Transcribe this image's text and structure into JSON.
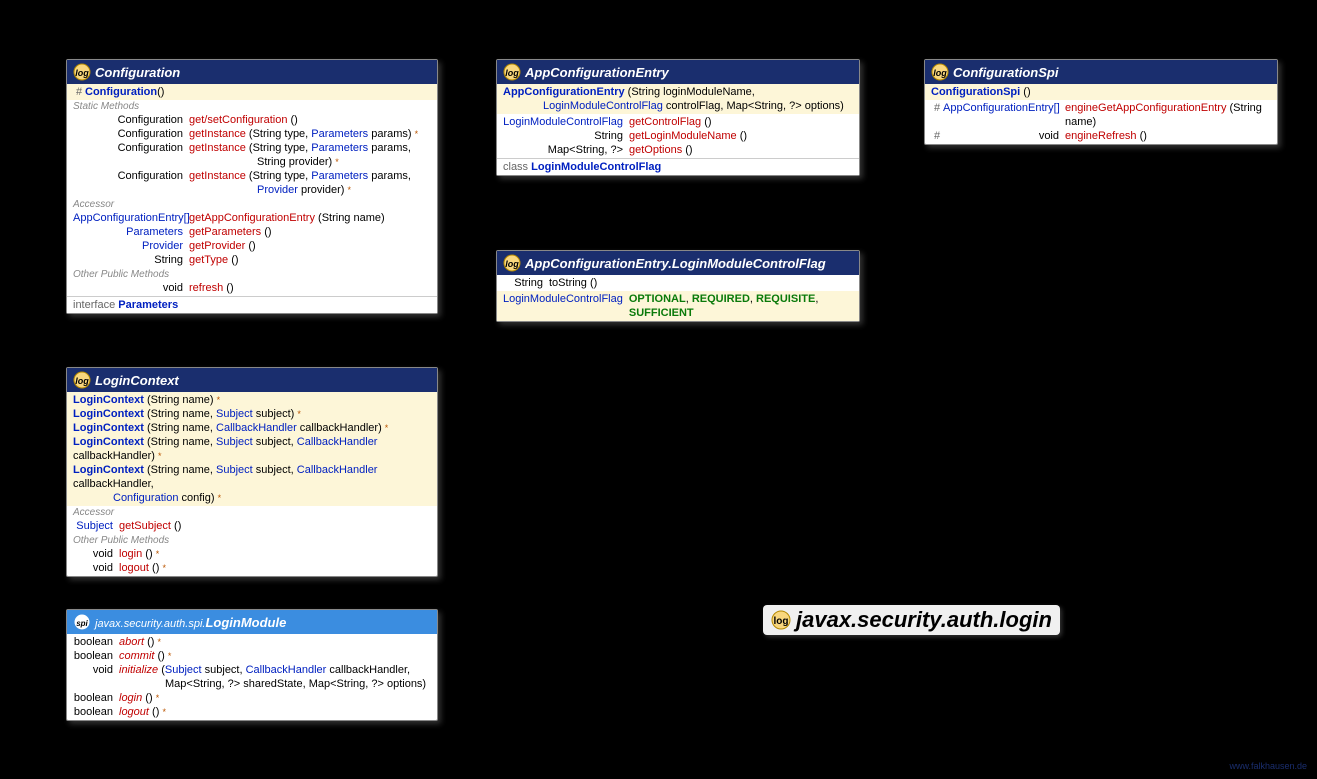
{
  "package_title": "javax.security.auth.login",
  "watermark": "www.falkhausen.de",
  "configuration": {
    "title": "Configuration",
    "ctor_name": "Configuration",
    "ctor_params": "()",
    "sec_static": "Static Methods",
    "sm1_ret": "Configuration",
    "sm1_name": "get/setConfiguration",
    "sm1_params": " ()",
    "sm2_ret": "Configuration",
    "sm2_name": "getInstance",
    "sm2_p1": " (String type, ",
    "sm2_p2": "Parameters",
    "sm2_p3": " params) ",
    "sm2_suf": "*",
    "sm3_ret": "Configuration",
    "sm3_name": "getInstance",
    "sm3_p1": " (String type, ",
    "sm3_p2": "Parameters",
    "sm3_p3": " params,",
    "sm3_cont": "String provider) ",
    "sm3_suf": "*",
    "sm4_ret": "Configuration",
    "sm4_name": "getInstance",
    "sm4_p1": " (String type, ",
    "sm4_p2": "Parameters",
    "sm4_p3": " params,",
    "sm4_cont_a": "Provider",
    "sm4_cont_b": " provider) ",
    "sm4_suf": "*",
    "sec_accessor": "Accessor",
    "a1_ret": "AppConfigurationEntry[]",
    "a1_name": "getAppConfigurationEntry",
    "a1_params": " (String name)",
    "a2_ret": "Parameters",
    "a2_name": "getParameters",
    "a2_params": " ()",
    "a3_ret": "Provider",
    "a3_name": "getProvider",
    "a3_params": " ()",
    "a4_ret": "String",
    "a4_name": "getType",
    "a4_params": " ()",
    "sec_other": "Other Public Methods",
    "o1_ret": "void",
    "o1_name": "refresh",
    "o1_params": " ()",
    "footer_kw": "interface",
    "footer_link": "Parameters"
  },
  "login_context": {
    "title": "LoginContext",
    "c1": "LoginContext",
    "c1p": " (String name) ",
    "c1s": "*",
    "c2": "LoginContext",
    "c2p1": " (String name, ",
    "c2p2": "Subject",
    "c2p3": " subject) ",
    "c2s": "*",
    "c3": "LoginContext",
    "c3p1": " (String name, ",
    "c3p2": "CallbackHandler",
    "c3p3": " callbackHandler) ",
    "c3s": "*",
    "c4": "LoginContext",
    "c4p1": " (String name, ",
    "c4p2": "Subject",
    "c4p3": " subject, ",
    "c4p4": "CallbackHandler",
    "c4p5": " callbackHandler) ",
    "c4s": "*",
    "c5": "LoginContext",
    "c5p1": " (String name, ",
    "c5p2": "Subject",
    "c5p3": " subject, ",
    "c5p4": "CallbackHandler",
    "c5p5": " callbackHandler,",
    "c5_cont_a": "Configuration",
    "c5_cont_b": " config) ",
    "c5s": "*",
    "sec_accessor": "Accessor",
    "a1_ret": "Subject",
    "a1_name": "getSubject",
    "a1_params": " ()",
    "sec_other": "Other Public Methods",
    "o1_ret": "void",
    "o1_name": "login",
    "o1_params": " () ",
    "o1s": "*",
    "o2_ret": "void",
    "o2_name": "logout",
    "o2_params": " () ",
    "o2s": "*"
  },
  "login_module": {
    "pkg": "javax.security.auth.spi.",
    "title": "LoginModule",
    "r1_ret": "boolean",
    "r1_name": "abort",
    "r1_params": " () ",
    "r1s": "*",
    "r2_ret": "boolean",
    "r2_name": "commit",
    "r2_params": " () ",
    "r2s": "*",
    "r3_ret": "void",
    "r3_name": "initialize",
    "r3_p1": " (",
    "r3_p2": "Subject",
    "r3_p3": " subject, ",
    "r3_p4": "CallbackHandler",
    "r3_p5": " callbackHandler,",
    "r3_cont": "Map<String, ?> sharedState, Map<String, ?> options)",
    "r4_ret": "boolean",
    "r4_name": "login",
    "r4_params": " () ",
    "r4s": "*",
    "r5_ret": "boolean",
    "r5_name": "logout",
    "r5_params": " () ",
    "r5s": "*"
  },
  "app_config_entry": {
    "title": "AppConfigurationEntry",
    "c1": "AppConfigurationEntry",
    "c1p": " (String loginModuleName,",
    "c1_cont_a": "LoginModuleControlFlag",
    "c1_cont_b": " controlFlag, Map<String, ?> options)",
    "r1_ret": "LoginModuleControlFlag",
    "r1_name": "getControlFlag",
    "r1_params": " ()",
    "r2_ret": "String",
    "r2_name": "getLoginModuleName",
    "r2_params": " ()",
    "r3_ret": "Map<String, ?>",
    "r3_name": "getOptions",
    "r3_params": " ()",
    "footer_kw": "class",
    "footer_link": "LoginModuleControlFlag"
  },
  "control_flag": {
    "title": "AppConfigurationEntry.LoginModuleControlFlag",
    "r1_ret": "String",
    "r1_name": "toString",
    "r1_params": " ()",
    "f_ret": "LoginModuleControlFlag",
    "f1": "OPTIONAL",
    "f2": "REQUIRED",
    "f3": "REQUISITE",
    "f4": "SUFFICIENT"
  },
  "config_spi": {
    "title": "ConfigurationSpi",
    "c1": "ConfigurationSpi",
    "c1p": " ()",
    "r1_ret": "AppConfigurationEntry[]",
    "r1_name": "engineGetAppConfigurationEntry",
    "r1_params": " (String name)",
    "r2_ret": "void",
    "r2_name": "engineRefresh",
    "r2_params": " ()"
  }
}
